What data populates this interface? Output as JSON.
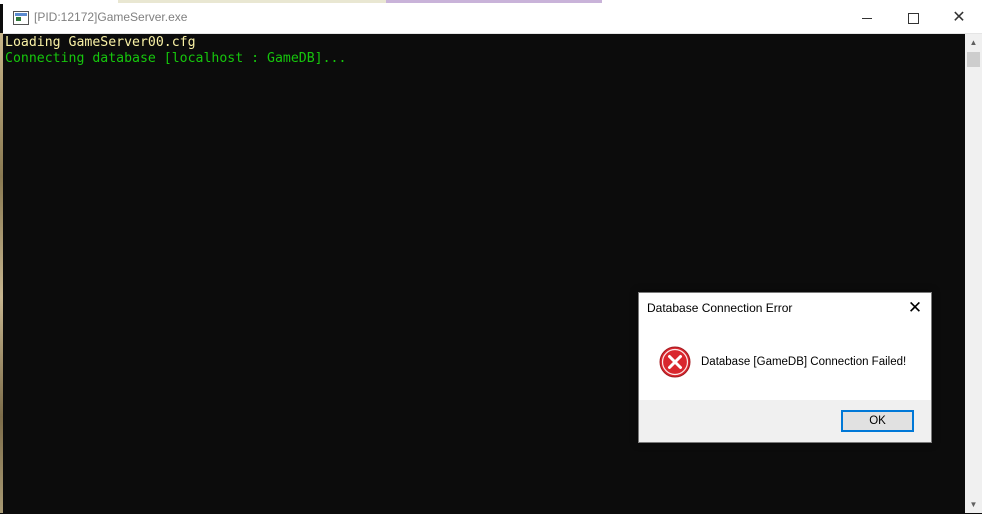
{
  "window": {
    "title": "[PID:12172]GameServer.exe",
    "min_glyph": "",
    "max_glyph": "",
    "close_glyph": "✕"
  },
  "console": {
    "lines": [
      {
        "text": "Loading GameServer00.cfg",
        "color": "#f9f1a5"
      },
      {
        "text": "Connecting database [localhost : GameDB]...",
        "color": "#16c60c"
      }
    ]
  },
  "scrollbar": {
    "up_glyph": "▲",
    "down_glyph": "▼"
  },
  "dialog": {
    "title": "Database Connection Error",
    "close_glyph": "✕",
    "icon": "error-icon",
    "message": "Database [GameDB] Connection Failed!",
    "ok_label": "OK"
  },
  "colors": {
    "console_bg": "#0c0c0c",
    "error_red": "#d9272e",
    "focus_blue": "#0078d7"
  }
}
